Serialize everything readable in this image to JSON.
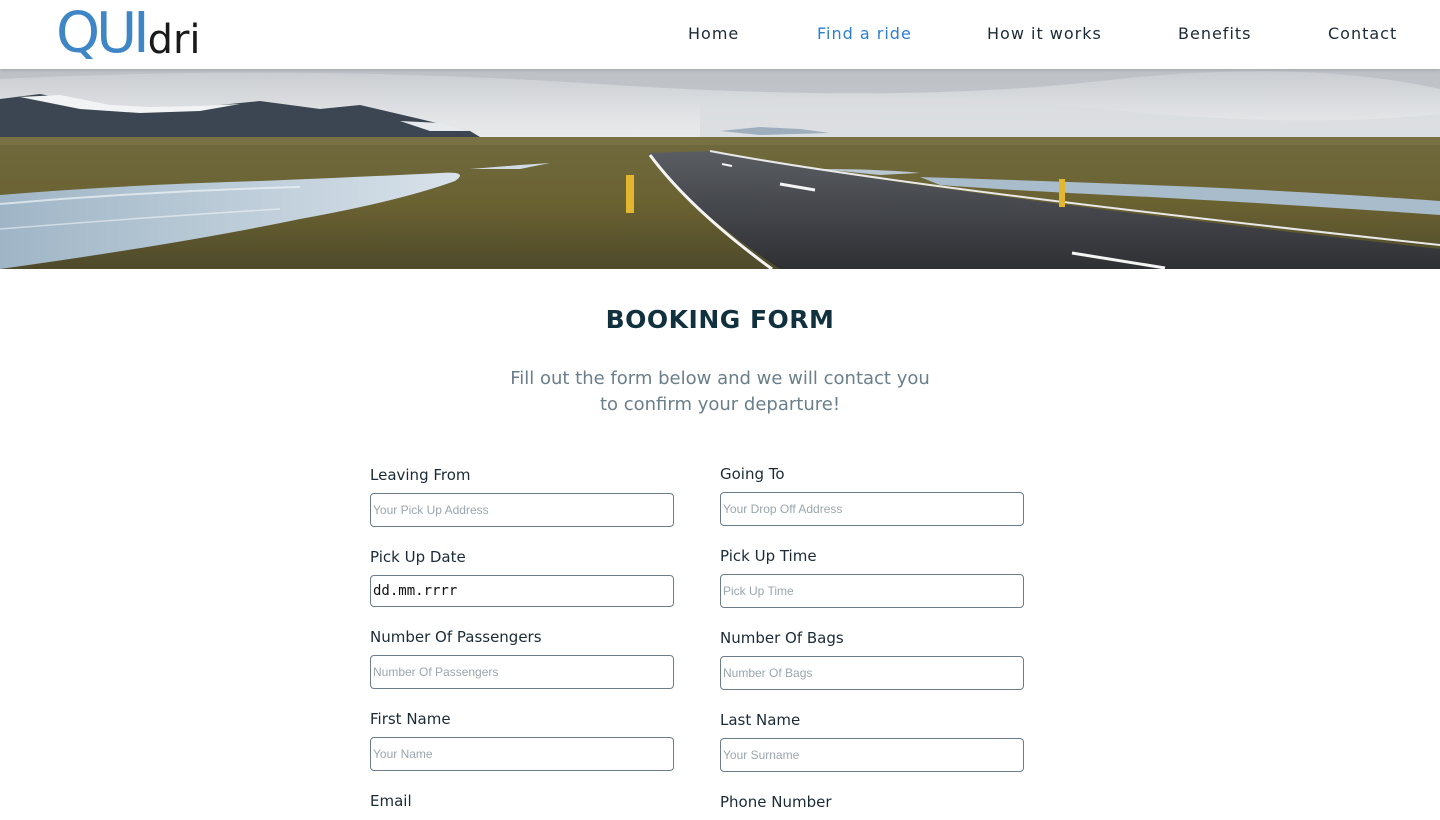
{
  "brand": {
    "logo_primary": "QUI",
    "logo_secondary": "dri",
    "primary_color": "#3f86c6",
    "secondary_color": "#1a1a1a"
  },
  "nav": {
    "items": [
      {
        "label": "Home",
        "active": false
      },
      {
        "label": "Find a ride",
        "active": true
      },
      {
        "label": "How it works",
        "active": false
      },
      {
        "label": "Benefits",
        "active": false
      },
      {
        "label": "Contact",
        "active": false
      }
    ],
    "active_color": "#2b7fd6"
  },
  "hero": {
    "image": "road-landscape-banner"
  },
  "form": {
    "title": "BOOKING FORM",
    "subtitle_line1": "Fill out the form below and we will contact you",
    "subtitle_line2": "to confirm your departure!",
    "fields": {
      "leaving_from": {
        "label": "Leaving From",
        "placeholder": "Your Pick Up Address",
        "value": ""
      },
      "going_to": {
        "label": "Going To",
        "placeholder": "Your Drop Off Address",
        "value": ""
      },
      "pickup_date": {
        "label": "Pick Up Date",
        "placeholder": "",
        "value": "dd.mm.rrrr"
      },
      "pickup_time": {
        "label": "Pick Up Time",
        "placeholder": "Pick Up Time",
        "value": ""
      },
      "passengers": {
        "label": "Number Of Passengers",
        "placeholder": "Number Of Passengers",
        "value": ""
      },
      "bags": {
        "label": "Number Of Bags",
        "placeholder": "Number Of Bags",
        "value": ""
      },
      "first_name": {
        "label": "First Name",
        "placeholder": "Your Name",
        "value": ""
      },
      "last_name": {
        "label": "Last Name",
        "placeholder": "Your Surname",
        "value": ""
      },
      "email": {
        "label": "Email"
      },
      "phone": {
        "label": "Phone Number"
      }
    }
  }
}
